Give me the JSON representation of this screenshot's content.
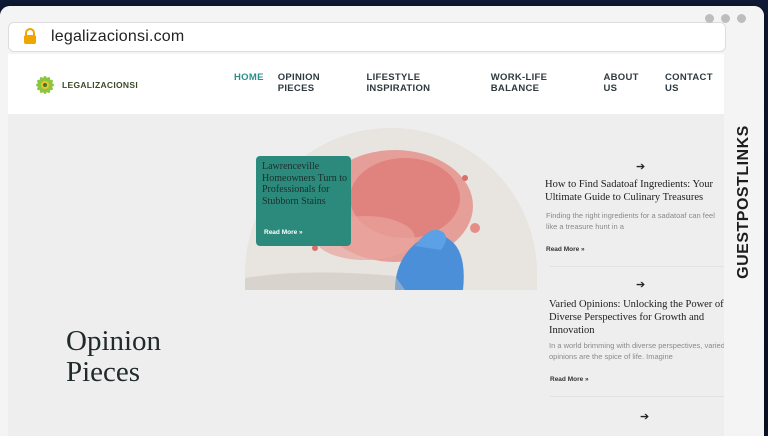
{
  "browser": {
    "url": "legalizacionsi.com"
  },
  "site": {
    "logo_text": "LEGALIZACIONSI",
    "nav": [
      {
        "label": "HOME",
        "active": true
      },
      {
        "label": "OPINION PIECES",
        "active": false
      },
      {
        "label": "LIFESTYLE INSPIRATION",
        "active": false
      },
      {
        "label": "WORK-LIFE BALANCE",
        "active": false
      },
      {
        "label": "ABOUT US",
        "active": false
      },
      {
        "label": "CONTACT US",
        "active": false
      }
    ],
    "accent_color": "#2a8f8a",
    "featured": {
      "title": "Lawrenceville Homeowners Turn to Professionals for Stubborn Stains",
      "read_more": "Read More »"
    },
    "posts": [
      {
        "title": "How to Find Sadatoaf Ingredients: Your Ultimate Guide to Culinary Treasures",
        "excerpt": "Finding the right ingredients for a sadatoaf can feel like a treasure hunt in a",
        "read_more": "Read More »"
      },
      {
        "title": "Varied Opinions: Unlocking the Power of Diverse Perspectives for Growth and Innovation",
        "excerpt": "In a world brimming with diverse perspectives, varied opinions are the spice of life. Imagine",
        "read_more": "Read More »"
      }
    ],
    "page_title_line1": "Opinion",
    "page_title_line2": "Pieces"
  },
  "watermark": {
    "text": "GUESTPOSTLINKS",
    "accent_color": "#e8512a"
  }
}
